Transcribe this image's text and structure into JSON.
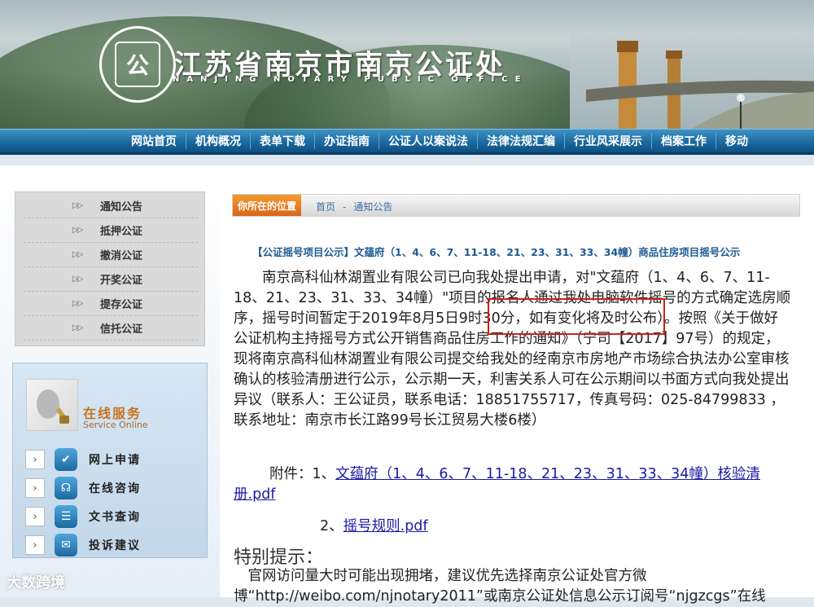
{
  "header": {
    "title": "江苏省南京市南京公证处",
    "subtitle": "NANJING NOTARY PUBLIC OFFICE",
    "seal_text": "NANJING NOTARY PUBLIC OFFICE"
  },
  "nav": {
    "items": [
      "网站首页",
      "机构概况",
      "表单下载",
      "办证指南",
      "公证人以案说法",
      "法律法规汇编",
      "行业风采展示",
      "档案工作",
      "移动"
    ]
  },
  "sidebar": {
    "menu": [
      "通知公告",
      "抵押公证",
      "撤消公证",
      "开奖公证",
      "提存公证",
      "信托公证"
    ],
    "service_title": "在线服务",
    "service_subtitle": "Service Online",
    "services": [
      "网上申请",
      "在线咨询",
      "文书查询",
      "投诉建议"
    ],
    "watermark": "大数跨境"
  },
  "breadcrumb": {
    "location_label": "你所在的位置",
    "items": [
      "首页",
      "通知公告"
    ]
  },
  "article": {
    "title": "【公证摇号项目公示】文蕴府（1、4、6、7、11-18、21、23、31、33、34幢）商品住房项目摇号公示",
    "body": "南京高科仙林湖置业有限公司已向我处提出申请，对\"文蕴府（1、4、6、7、11-18、21、23、31、33、34幢）\"项目的报名人通过我处电脑软件摇号的方式确定选房顺序，摇号时间暂定于2019年8月5日9时30分，如有变化将及时公布）。按照《关于做好公证机构主持摇号方式公开销售商品住房工作的通知》（宁司【2017】97号）的规定，现将南京高科仙林湖置业有限公司提交给我处的经南京市房地产市场综合执法办公室审核确认的核验清册进行公示，公示期一天，利害关系人可在公示期间以书面方式向我处提出异议（联系人：王公证员，联系电话：18851755717，传真号码：025-84799833 ，联系地址：南京市长江路99号长江贸易大楼6楼）",
    "attachments_label": "附件：1、",
    "attachment1": "文蕴府（1、4、6、7、11-18、21、23、31、33、34幢）核验清册.pdf",
    "attachment2_prefix": "2、",
    "attachment2": "摇号规则.pdf",
    "notice_title": "特别提示：",
    "notice_text": "官网访问量大时可能出现拥堵，建议优先选择南京公证处官方微博“http://weibo.com/njnotary2011”或南京公证处信息公示订阅号“njgzcgs”在线"
  }
}
